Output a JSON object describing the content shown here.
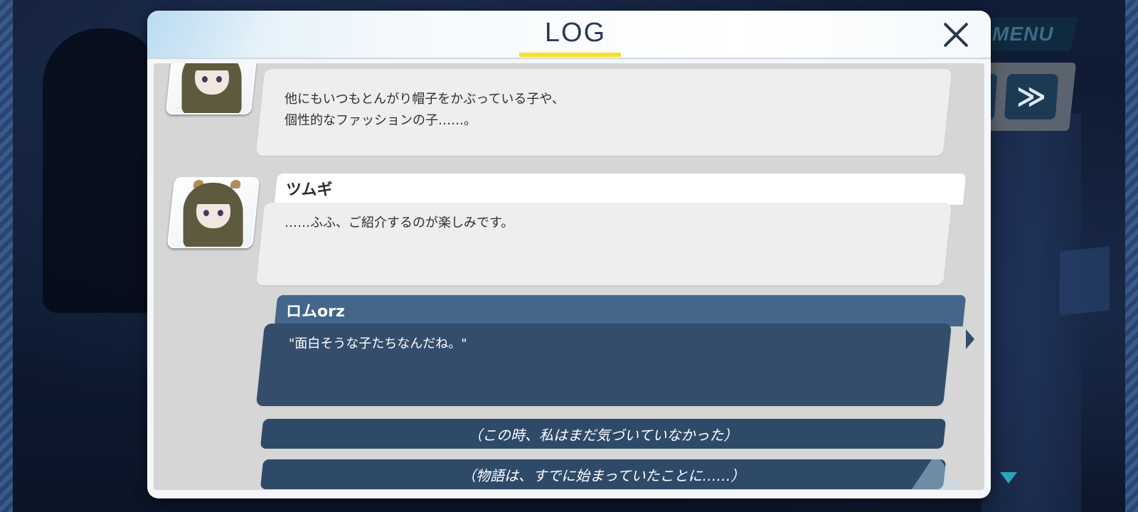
{
  "hud": {
    "menu_label": "MENU",
    "skip_label": "≫"
  },
  "log_window": {
    "title": "LOG",
    "entries": [
      {
        "speaker": "",
        "lines": [
          "他にもいつもとんがり帽子をかぶっている子や、",
          "個性的なファッションの子……。"
        ]
      },
      {
        "speaker": "ツムギ",
        "lines": [
          "……ふふ、ご紹介するのが楽しみです。"
        ]
      },
      {
        "speaker": "ロムorz",
        "lines": [
          "\"面白そうな子たちなんだね。\""
        ]
      }
    ],
    "narration": [
      "（この時、私はまだ気づいていなかった）",
      "（物語は、すでに始まっていたことに……）"
    ]
  },
  "colors": {
    "accent_underline": "#f5e12e",
    "player_bubble": "#344d6b",
    "player_nameplate": "#44668b",
    "narration_bar": "#2f4a69"
  }
}
